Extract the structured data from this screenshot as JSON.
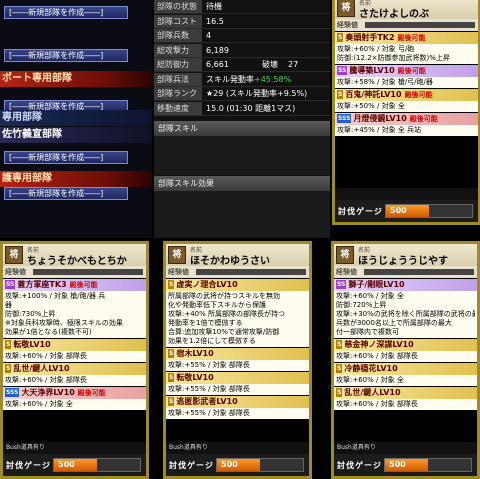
{
  "sidebar": {
    "items": [
      {
        "kind": "button",
        "label": "[――新規部隊を作成――]"
      },
      {
        "kind": "button",
        "label": "[――新規部隊を作成――]"
      },
      {
        "kind": "header",
        "style": "red",
        "label": "ポート専用部隊"
      },
      {
        "kind": "button",
        "label": "[――新規部隊を作成――]"
      },
      {
        "kind": "header",
        "style": "blue",
        "label": "専用部隊"
      },
      {
        "kind": "header",
        "style": "navy",
        "label": "佐竹義宣部隊"
      },
      {
        "kind": "button",
        "label": "[――新規部隊を作成――]"
      },
      {
        "kind": "header",
        "style": "red",
        "label": "護専用部隊"
      },
      {
        "kind": "button",
        "label": "[――新規部隊を作成――]"
      }
    ]
  },
  "stats": {
    "rows": [
      {
        "label": "部隊の状態",
        "value": "待機"
      },
      {
        "label": "部隊コスト",
        "value": "16.5"
      },
      {
        "label": "部隊兵数",
        "value": "4"
      },
      {
        "label": "総攻撃力",
        "value": "6,189"
      },
      {
        "label": "総防御力",
        "value": "6,661",
        "extra_label": "破壊",
        "extra_value": "27"
      },
      {
        "label": "部隊兵法",
        "value": "スキル発動率",
        "highlight": "+45.58%"
      },
      {
        "label": "部隊ランク",
        "value": "★29 (スキル発動率+9.5%)"
      },
      {
        "label": "移動速度",
        "value": "15.0 (01:30 距離1マス)"
      }
    ],
    "section_skill": "部隊スキル",
    "section_effect": "部隊スキル効果"
  },
  "cards": [
    {
      "id": "top-right",
      "avatar": "将",
      "name_label": "名前",
      "name": "さたけよしのぶ",
      "exp_label": "経験値",
      "skills": [
        {
          "rank": "S",
          "title": "奏頭射手TK2",
          "tag": "殿後可能",
          "lines": [
            "攻撃:+60% / 対象 弓/砲",
            "防御:(12.2×防御参加武将数)%上昇"
          ]
        },
        {
          "rank": "SS",
          "title": "騰導築LV10",
          "tag": "殿後可能",
          "lines": [
            "攻撃:+58% / 対象 槍/弓/砲/器"
          ]
        },
        {
          "rank": "S",
          "title": "百鬼/神託LV10",
          "tag": "殿後可能",
          "lines": [
            "攻撃:+50% / 対象 全"
          ]
        },
        {
          "rank": "SSS",
          "title": "月燈侵鏡LV10",
          "tag": "殿後可能",
          "lines": [
            "攻撃:+45% / 対象 全 兵站"
          ]
        }
      ],
      "footer": "",
      "gauge_label": "討伐ゲージ",
      "gauge_value": "500",
      "gauge_fraction": 0.5
    },
    {
      "id": "bottom-left",
      "avatar": "将",
      "name_label": "名前",
      "name": "ちょうそかべもとちか",
      "exp_label": "経験値",
      "skills": [
        {
          "rank": "SS",
          "title": "蓋方軍座TK3",
          "tag": "殿後可能",
          "lines": [
            "攻撃:+100% / 対象 槍/砲/器 兵",
            "器",
            "防御:730%上昇",
            "※対象兵科攻撃時、極限スキルの効果",
            "効果が1倍となる(複数不可)"
          ]
        },
        {
          "rank": "S",
          "title": "転敬LV10",
          "tag": "",
          "lines": [
            "攻撃:+60% / 対象 部隊長"
          ]
        },
        {
          "rank": "S",
          "title": "乱世/鍵人LV10",
          "tag": "",
          "lines": [
            "攻撃:+60% / 対象 部隊長"
          ]
        },
        {
          "rank": "SSS",
          "title": "大天浄界LV10",
          "tag": "殿後可能",
          "lines": [
            "攻撃:+60% / 対象 全"
          ]
        }
      ],
      "footer": "Bush道具有り",
      "gauge_label": "討伐ゲージ",
      "gauge_value": "500",
      "gauge_fraction": 0.5
    },
    {
      "id": "bottom-middle",
      "avatar": "将",
      "name_label": "名前",
      "name": "ほそかわゆうさい",
      "exp_label": "経験値",
      "skills": [
        {
          "rank": "S",
          "title": "虚実ノ理合LV10",
          "tag": "",
          "lines": [
            "所属部隊の武将が持つスキルを無効",
            "化や発動率低下スキルから保護",
            "攻撃:+40% 所属部隊の部隊長が持つ",
            "発動率を1倍で模倣する",
            "合算:追加攻撃10%で通常攻撃/防御",
            "効果を1.2倍にして模倣する"
          ]
        },
        {
          "rank": "S",
          "title": "宿木LV10",
          "tag": "",
          "lines": [
            "攻撃:+55% / 対象 部隊長"
          ]
        },
        {
          "rank": "S",
          "title": "転敬LV10",
          "tag": "",
          "lines": [
            "攻撃:+55% / 対象 部隊長"
          ]
        },
        {
          "rank": "S",
          "title": "逃匿影武者LV10",
          "tag": "",
          "lines": [
            "攻撃:+55% / 対象 部隊長"
          ]
        }
      ],
      "footer": "Bush道具有り",
      "gauge_label": "討伐ゲージ",
      "gauge_value": "500",
      "gauge_fraction": 0.5
    },
    {
      "id": "bottom-right",
      "avatar": "将",
      "name_label": "名前",
      "name": "ほうじょううじやす",
      "exp_label": "経験値",
      "skills": [
        {
          "rank": "SS",
          "title": "獅子/剛眼LV10",
          "tag": "",
          "lines": [
            "攻撃:+60% / 対象 全",
            "防御:720%上昇",
            "攻撃:+30%の武将を除く所属部隊の武将の最大",
            "兵数が3000名以上で所属部隊の最大",
            "付一部隊内で複数可"
          ]
        },
        {
          "rank": "S",
          "title": "慈金神ノ深謀LV10",
          "tag": "",
          "lines": [
            "攻撃:+60% / 対象 部隊長"
          ]
        },
        {
          "rank": "S",
          "title": "冷静穏花LV10",
          "tag": "",
          "lines": [
            "攻撃:+60% / 対象 全"
          ]
        },
        {
          "rank": "S",
          "title": "乱世/鍵人LV10",
          "tag": "",
          "lines": [
            "攻撃:+60% / 対象 部隊長"
          ]
        }
      ],
      "footer": "Bush道具有り",
      "gauge_label": "討伐ゲージ",
      "gauge_value": "500",
      "gauge_fraction": 0.5
    }
  ]
}
